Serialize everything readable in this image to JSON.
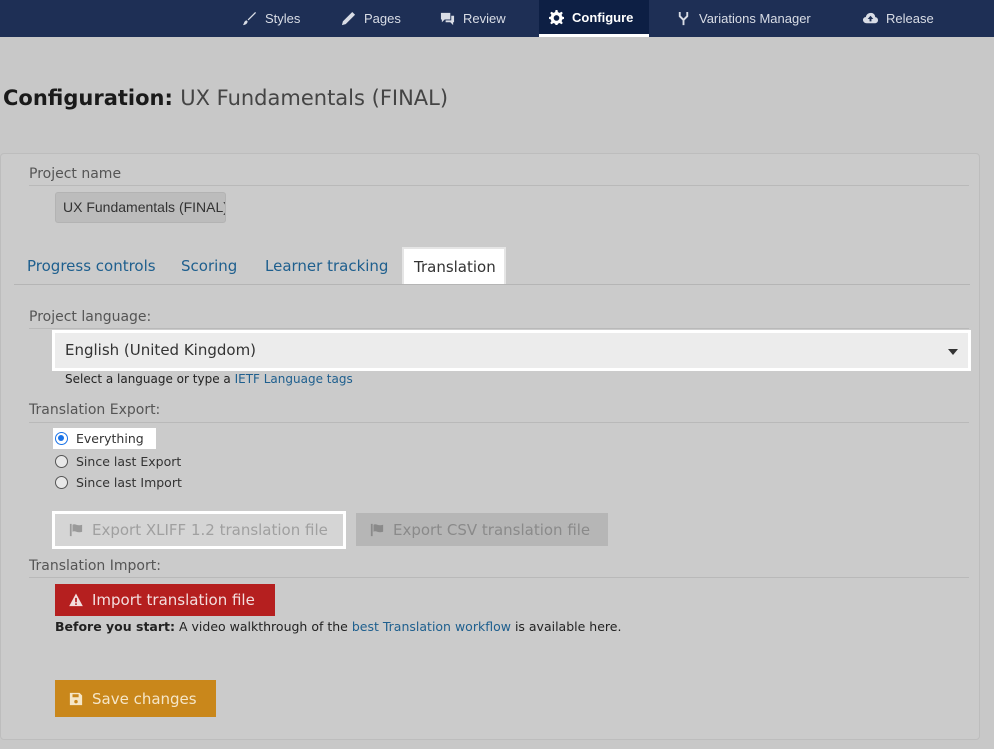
{
  "nav": {
    "items": [
      {
        "label": "Styles",
        "icon": "brush-icon"
      },
      {
        "label": "Pages",
        "icon": "pencil-icon"
      },
      {
        "label": "Review",
        "icon": "comments-icon"
      },
      {
        "label": "Configure",
        "icon": "gear-icon",
        "active": true
      },
      {
        "label": "Variations Manager",
        "icon": "fork-icon"
      },
      {
        "label": "Release",
        "icon": "cloud-upload-icon"
      }
    ]
  },
  "header": {
    "title_prefix": "Configuration:",
    "project": "UX Fundamentals (FINAL)"
  },
  "project_name": {
    "label": "Project name",
    "value": "UX Fundamentals (FINAL)"
  },
  "tabs": [
    {
      "label": "Progress controls"
    },
    {
      "label": "Scoring"
    },
    {
      "label": "Learner tracking"
    },
    {
      "label": "Translation",
      "active": true
    }
  ],
  "language": {
    "label": "Project language:",
    "selected": "English (United Kingdom)",
    "help_text": "Select a language or type a",
    "help_link": "IETF Language tags"
  },
  "export": {
    "label": "Translation Export:",
    "options": [
      {
        "label": "Everything",
        "checked": true
      },
      {
        "label": "Since last Export",
        "checked": false
      },
      {
        "label": "Since last Import",
        "checked": false
      }
    ],
    "xliff_button": "Export XLIFF 1.2 translation file",
    "csv_button": "Export CSV translation file"
  },
  "import": {
    "label": "Translation Import:",
    "button": "Import translation file",
    "note_bold": "Before you start:",
    "note_text": "A video walkthrough of the",
    "note_link": "best Translation workflow",
    "note_tail": "is available here."
  },
  "save_button": "Save changes",
  "colors": {
    "nav_bg": "#1e2f55",
    "link": "#1e5f8e",
    "import_red": "#b51f1f",
    "save_orange": "#c9871b",
    "radio_blue": "#1a73e8"
  }
}
